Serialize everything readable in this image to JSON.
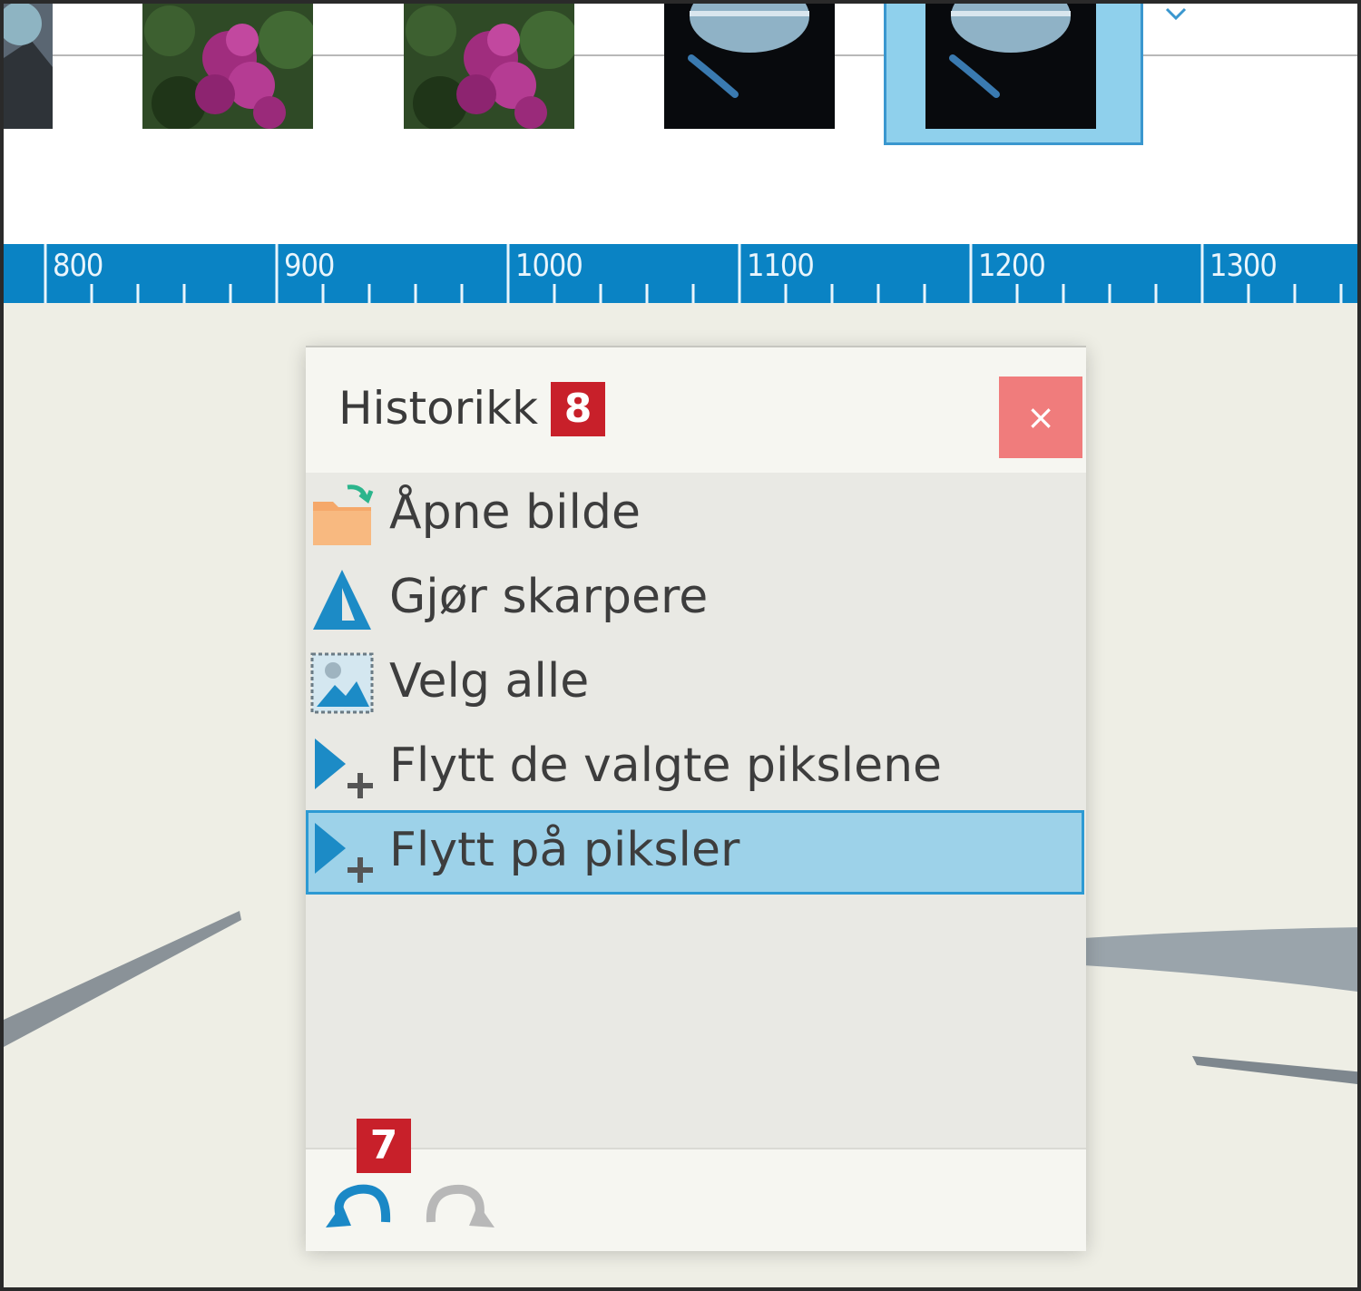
{
  "ruler": {
    "labels": [
      "800",
      "900",
      "1000",
      "1100",
      "1200",
      "1300"
    ]
  },
  "history": {
    "title": "Historikk",
    "title_badge": "8",
    "close_label": "×",
    "items": [
      {
        "label": "Åpne bilde",
        "icon": "open-image-icon"
      },
      {
        "label": "Gjør skarpere",
        "icon": "sharpen-icon"
      },
      {
        "label": "Velg alle",
        "icon": "select-all-icon"
      },
      {
        "label": "Flytt de valgte pikslene",
        "icon": "move-selection-icon"
      },
      {
        "label": "Flytt på piksler",
        "icon": "move-pixels-icon",
        "selected": true
      }
    ],
    "footer_badge": "7",
    "undo_icon": "undo-icon",
    "redo_icon": "redo-icon"
  },
  "colors": {
    "ruler": "#0a83c4",
    "selection": "#9dd2e9",
    "close": "#f07c7c",
    "badge": "#c8202a",
    "undo": "#1a88c6",
    "redo": "#b8b8b8"
  }
}
